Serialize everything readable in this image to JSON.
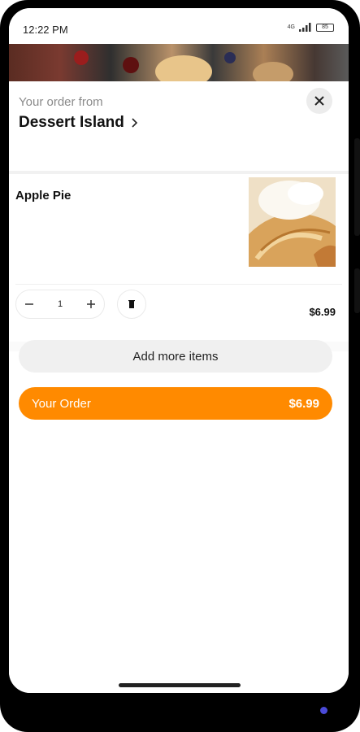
{
  "status_bar": {
    "time": "12:22 PM",
    "network": "4G",
    "battery": "85"
  },
  "header": {
    "from_label": "Your order from",
    "restaurant_name": "Dessert Island",
    "chevron_icon": "chevron-right-icon",
    "close_icon": "close-icon"
  },
  "cart": {
    "items": [
      {
        "name": "Apple Pie",
        "quantity": "1",
        "price": "$6.99"
      }
    ]
  },
  "actions": {
    "add_more_label": "Add more items",
    "order_label": "Your Order",
    "order_total": "$6.99"
  },
  "colors": {
    "accent": "#ff8a00",
    "button_grey": "#f0f0f0"
  }
}
